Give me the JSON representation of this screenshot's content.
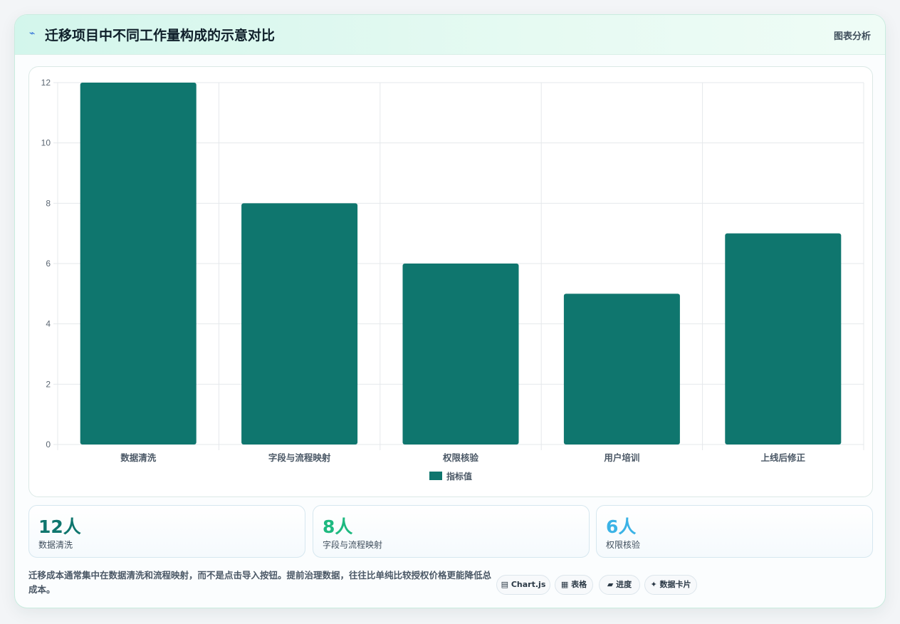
{
  "header": {
    "icon": "line-chart-icon",
    "title": "迁移项目中不同工作量构成的示意对比",
    "tag": "图表分析"
  },
  "chart_data": {
    "type": "bar",
    "categories": [
      "数据清洗",
      "字段与流程映射",
      "权限核验",
      "用户培训",
      "上线后修正"
    ],
    "series": [
      {
        "name": "指标值",
        "values": [
          12,
          8,
          6,
          5,
          7
        ],
        "color": "#0f766e"
      }
    ],
    "ylim": [
      0,
      12
    ],
    "yticks": [
      0,
      2,
      4,
      6,
      8,
      10,
      12
    ],
    "grid": true,
    "legend": "bottom"
  },
  "stats": [
    {
      "value": "12人",
      "label": "数据清洗",
      "color": "#0f766e"
    },
    {
      "value": "8人",
      "label": "字段与流程映射",
      "color": "#1eb980"
    },
    {
      "value": "6人",
      "label": "权限核验",
      "color": "#3bb3e6"
    }
  ],
  "note": "迁移成本通常集中在数据清洗和流程映射，而不是点击导入按钮。提前治理数据，往往比单纯比较授权价格更能降低总成本。",
  "badges": [
    {
      "icon": "▤",
      "label": "Chart.js"
    },
    {
      "icon": "▦",
      "label": "表格"
    },
    {
      "icon": "▰",
      "label": "进度"
    },
    {
      "icon": "✦",
      "label": "数据卡片"
    }
  ]
}
